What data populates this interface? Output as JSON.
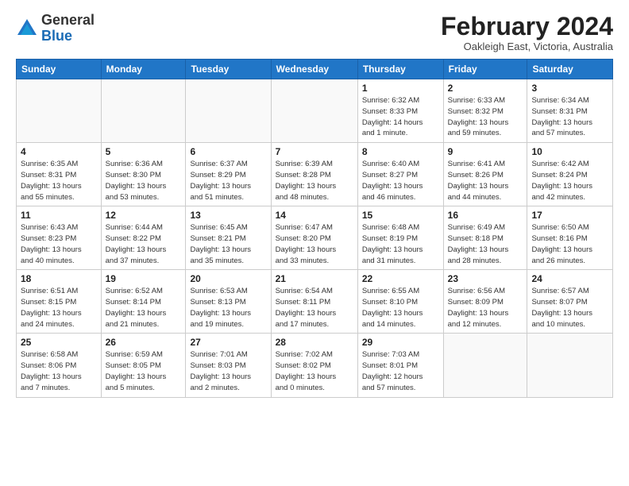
{
  "header": {
    "logo_general": "General",
    "logo_blue": "Blue",
    "month_title": "February 2024",
    "location": "Oakleigh East, Victoria, Australia"
  },
  "days_of_week": [
    "Sunday",
    "Monday",
    "Tuesday",
    "Wednesday",
    "Thursday",
    "Friday",
    "Saturday"
  ],
  "weeks": [
    [
      {
        "day": "",
        "info": ""
      },
      {
        "day": "",
        "info": ""
      },
      {
        "day": "",
        "info": ""
      },
      {
        "day": "",
        "info": ""
      },
      {
        "day": "1",
        "info": "Sunrise: 6:32 AM\nSunset: 8:33 PM\nDaylight: 14 hours\nand 1 minute."
      },
      {
        "day": "2",
        "info": "Sunrise: 6:33 AM\nSunset: 8:32 PM\nDaylight: 13 hours\nand 59 minutes."
      },
      {
        "day": "3",
        "info": "Sunrise: 6:34 AM\nSunset: 8:31 PM\nDaylight: 13 hours\nand 57 minutes."
      }
    ],
    [
      {
        "day": "4",
        "info": "Sunrise: 6:35 AM\nSunset: 8:31 PM\nDaylight: 13 hours\nand 55 minutes."
      },
      {
        "day": "5",
        "info": "Sunrise: 6:36 AM\nSunset: 8:30 PM\nDaylight: 13 hours\nand 53 minutes."
      },
      {
        "day": "6",
        "info": "Sunrise: 6:37 AM\nSunset: 8:29 PM\nDaylight: 13 hours\nand 51 minutes."
      },
      {
        "day": "7",
        "info": "Sunrise: 6:39 AM\nSunset: 8:28 PM\nDaylight: 13 hours\nand 48 minutes."
      },
      {
        "day": "8",
        "info": "Sunrise: 6:40 AM\nSunset: 8:27 PM\nDaylight: 13 hours\nand 46 minutes."
      },
      {
        "day": "9",
        "info": "Sunrise: 6:41 AM\nSunset: 8:26 PM\nDaylight: 13 hours\nand 44 minutes."
      },
      {
        "day": "10",
        "info": "Sunrise: 6:42 AM\nSunset: 8:24 PM\nDaylight: 13 hours\nand 42 minutes."
      }
    ],
    [
      {
        "day": "11",
        "info": "Sunrise: 6:43 AM\nSunset: 8:23 PM\nDaylight: 13 hours\nand 40 minutes."
      },
      {
        "day": "12",
        "info": "Sunrise: 6:44 AM\nSunset: 8:22 PM\nDaylight: 13 hours\nand 37 minutes."
      },
      {
        "day": "13",
        "info": "Sunrise: 6:45 AM\nSunset: 8:21 PM\nDaylight: 13 hours\nand 35 minutes."
      },
      {
        "day": "14",
        "info": "Sunrise: 6:47 AM\nSunset: 8:20 PM\nDaylight: 13 hours\nand 33 minutes."
      },
      {
        "day": "15",
        "info": "Sunrise: 6:48 AM\nSunset: 8:19 PM\nDaylight: 13 hours\nand 31 minutes."
      },
      {
        "day": "16",
        "info": "Sunrise: 6:49 AM\nSunset: 8:18 PM\nDaylight: 13 hours\nand 28 minutes."
      },
      {
        "day": "17",
        "info": "Sunrise: 6:50 AM\nSunset: 8:16 PM\nDaylight: 13 hours\nand 26 minutes."
      }
    ],
    [
      {
        "day": "18",
        "info": "Sunrise: 6:51 AM\nSunset: 8:15 PM\nDaylight: 13 hours\nand 24 minutes."
      },
      {
        "day": "19",
        "info": "Sunrise: 6:52 AM\nSunset: 8:14 PM\nDaylight: 13 hours\nand 21 minutes."
      },
      {
        "day": "20",
        "info": "Sunrise: 6:53 AM\nSunset: 8:13 PM\nDaylight: 13 hours\nand 19 minutes."
      },
      {
        "day": "21",
        "info": "Sunrise: 6:54 AM\nSunset: 8:11 PM\nDaylight: 13 hours\nand 17 minutes."
      },
      {
        "day": "22",
        "info": "Sunrise: 6:55 AM\nSunset: 8:10 PM\nDaylight: 13 hours\nand 14 minutes."
      },
      {
        "day": "23",
        "info": "Sunrise: 6:56 AM\nSunset: 8:09 PM\nDaylight: 13 hours\nand 12 minutes."
      },
      {
        "day": "24",
        "info": "Sunrise: 6:57 AM\nSunset: 8:07 PM\nDaylight: 13 hours\nand 10 minutes."
      }
    ],
    [
      {
        "day": "25",
        "info": "Sunrise: 6:58 AM\nSunset: 8:06 PM\nDaylight: 13 hours\nand 7 minutes."
      },
      {
        "day": "26",
        "info": "Sunrise: 6:59 AM\nSunset: 8:05 PM\nDaylight: 13 hours\nand 5 minutes."
      },
      {
        "day": "27",
        "info": "Sunrise: 7:01 AM\nSunset: 8:03 PM\nDaylight: 13 hours\nand 2 minutes."
      },
      {
        "day": "28",
        "info": "Sunrise: 7:02 AM\nSunset: 8:02 PM\nDaylight: 13 hours\nand 0 minutes."
      },
      {
        "day": "29",
        "info": "Sunrise: 7:03 AM\nSunset: 8:01 PM\nDaylight: 12 hours\nand 57 minutes."
      },
      {
        "day": "",
        "info": ""
      },
      {
        "day": "",
        "info": ""
      }
    ]
  ]
}
